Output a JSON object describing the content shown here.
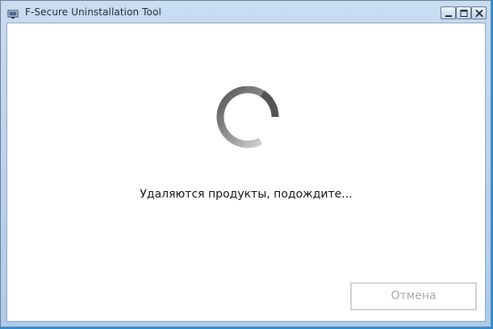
{
  "window": {
    "title": "F-Secure Uninstallation Tool",
    "icon": "app-monitor-icon"
  },
  "caption_buttons": {
    "minimize_icon": "minimize-icon",
    "maximize_icon": "maximize-icon",
    "close_icon": "close-icon"
  },
  "main": {
    "spinner_icon": "loading-spinner-icon",
    "status_text": "Удаляются продукты, подождите...",
    "cancel_label": "Отмена",
    "cancel_enabled": false
  },
  "colors": {
    "title_bar": "#b9d1ec",
    "client_background": "#ffffff",
    "status_text": "#111111",
    "disabled_button_text": "#a8a8a8",
    "disabled_button_border": "#d2d2d2"
  }
}
